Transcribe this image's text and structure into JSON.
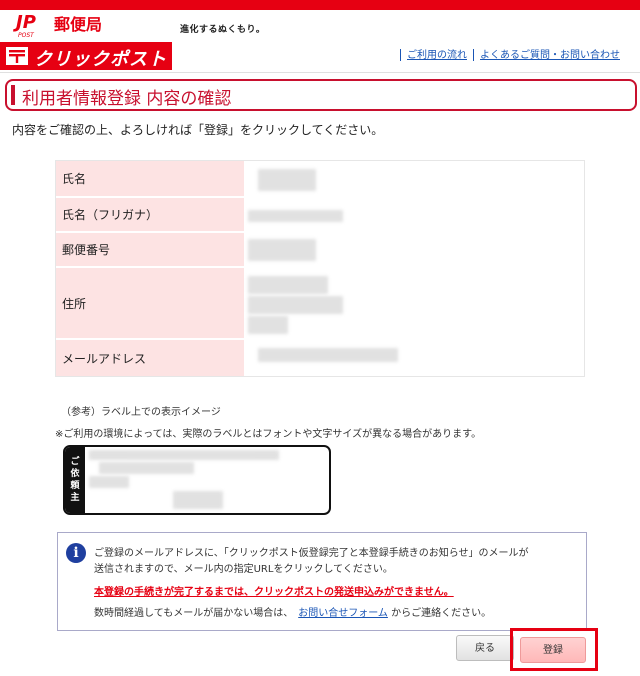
{
  "header": {
    "brand_top": "JP",
    "brand_sub": "POST",
    "brand_name": "郵便局",
    "tagline": "進化するぬくもり。",
    "service_logo": "クリックポスト",
    "links": [
      {
        "label": "ご利用の流れ"
      },
      {
        "label": "よくあるご質問・お問い合わせ"
      }
    ]
  },
  "page_title": "利用者情報登録 内容の確認",
  "intro_text": "内容をご確認の上、よろしければ「登録」をクリックしてください。",
  "fields": [
    {
      "label": "氏名"
    },
    {
      "label": "氏名（フリガナ）"
    },
    {
      "label": "郵便番号"
    },
    {
      "label": "住所"
    },
    {
      "label": "メールアドレス"
    }
  ],
  "label_preview": {
    "title": "（参考）ラベル上での表示イメージ",
    "note": "※ご利用の環境によっては、実際のラベルとはフォントや文字サイズが異なる場合があります。",
    "side_chars": [
      "ご",
      "依",
      "頼",
      "主"
    ]
  },
  "notice": {
    "icon": "info-icon",
    "line1": "ご登録のメールアドレスに、「クリックポスト仮登録完了と本登録手続きのお知らせ」のメールが",
    "line2": "送信されますので、メール内の指定URLをクリックしてください。",
    "warning": "本登録の手続きが完了するまでは、クリックポストの発送申込みができません。",
    "line4_before": "数時間経過してもメールが届かない場合は、",
    "line4_link": "お問い合せフォーム",
    "line4_after": "からご連絡ください。"
  },
  "buttons": {
    "back": "戻る",
    "register": "登録"
  },
  "colors": {
    "brand_red": "#e60012",
    "label_bg": "#fde3e3",
    "link_blue": "#1a55b5",
    "icon_blue": "#1f3f9f"
  }
}
